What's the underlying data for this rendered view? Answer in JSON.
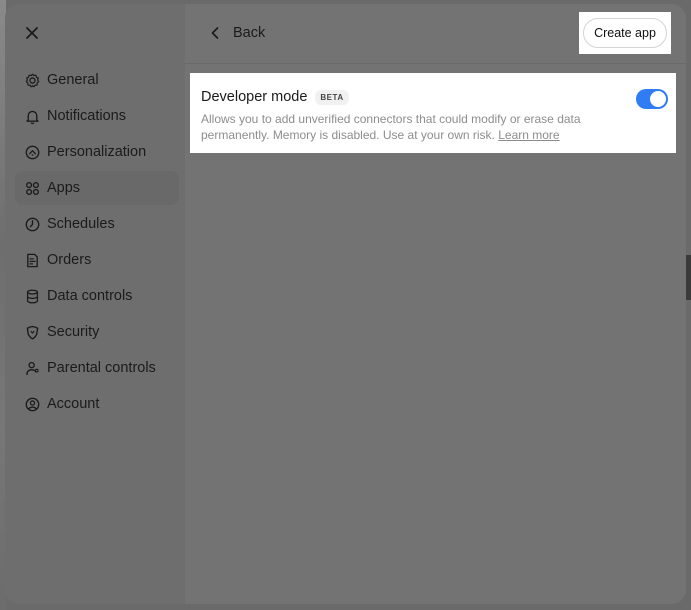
{
  "sidebar": {
    "items": [
      {
        "label": "General",
        "icon": "gear-icon"
      },
      {
        "label": "Notifications",
        "icon": "bell-icon"
      },
      {
        "label": "Personalization",
        "icon": "personalization-icon"
      },
      {
        "label": "Apps",
        "icon": "apps-grid-icon",
        "active": true
      },
      {
        "label": "Schedules",
        "icon": "clock-icon"
      },
      {
        "label": "Orders",
        "icon": "receipt-icon"
      },
      {
        "label": "Data controls",
        "icon": "database-icon"
      },
      {
        "label": "Security",
        "icon": "shield-icon"
      },
      {
        "label": "Parental controls",
        "icon": "family-icon"
      },
      {
        "label": "Account",
        "icon": "user-circle-icon"
      }
    ]
  },
  "header": {
    "back_label": "Back",
    "create_app_label": "Create app"
  },
  "developer_mode": {
    "title": "Developer mode",
    "badge": "BETA",
    "description": "Allows you to add unverified connectors that could modify or erase data permanently. Memory is disabled. Use at your own risk.",
    "learn_more": "Learn more",
    "enabled": true
  },
  "colors": {
    "toggle_on": "#2f7cf6",
    "overlay": "#737373"
  }
}
